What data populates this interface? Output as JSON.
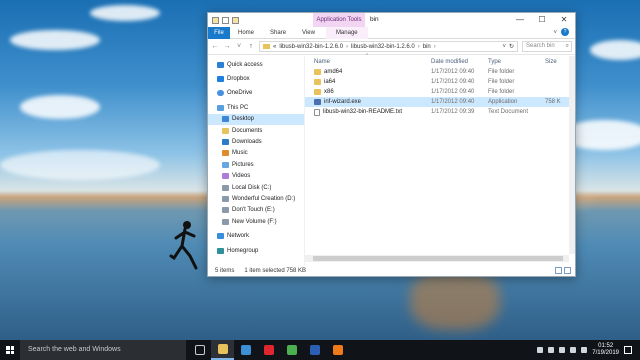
{
  "window": {
    "context_tab": "Application Tools",
    "title": "bin",
    "controls": {
      "minimize": "—",
      "maximize": "☐",
      "close": "✕"
    }
  },
  "ribbon": {
    "file": "File",
    "tabs": [
      "Home",
      "Share",
      "View"
    ],
    "manage": "Manage",
    "help": "?",
    "expand": "˅"
  },
  "address": {
    "back": "←",
    "forward": "→",
    "recent": "˅",
    "up": "↑",
    "prefix": "«",
    "crumbs": [
      "libusb-win32-bin-1.2.6.0",
      "libusb-win32-bin-1.2.6.0",
      "bin"
    ],
    "dropdown": "˅",
    "refresh": "↻",
    "search_placeholder": "Search bin",
    "search_icon": "⌕"
  },
  "nav": {
    "items": [
      {
        "label": "Quick access",
        "icon": "star-icon",
        "sub": false,
        "gap": false
      },
      {
        "label": "Dropbox",
        "icon": "dropbox-icon",
        "sub": false,
        "gap": true
      },
      {
        "label": "OneDrive",
        "icon": "cloud-icon",
        "sub": false,
        "gap": true
      },
      {
        "label": "This PC",
        "icon": "computer-icon",
        "sub": false,
        "gap": true
      },
      {
        "label": "Desktop",
        "icon": "desktop-folder-icon",
        "sub": true,
        "gap": false,
        "selected": true
      },
      {
        "label": "Documents",
        "icon": "documents-folder-icon",
        "sub": true,
        "gap": false
      },
      {
        "label": "Downloads",
        "icon": "downloads-folder-icon",
        "sub": true,
        "gap": false
      },
      {
        "label": "Music",
        "icon": "music-folder-icon",
        "sub": true,
        "gap": false
      },
      {
        "label": "Pictures",
        "icon": "pictures-folder-icon",
        "sub": true,
        "gap": false
      },
      {
        "label": "Videos",
        "icon": "videos-folder-icon",
        "sub": true,
        "gap": false
      },
      {
        "label": "Local Disk (C:)",
        "icon": "disk-icon",
        "sub": true,
        "gap": false
      },
      {
        "label": "Wonderful Creation (D:)",
        "icon": "disk-icon",
        "sub": true,
        "gap": false
      },
      {
        "label": "Don't Touch (E:)",
        "icon": "disk-icon",
        "sub": true,
        "gap": false
      },
      {
        "label": "New Volume (F:)",
        "icon": "disk-icon",
        "sub": true,
        "gap": false
      },
      {
        "label": "Network",
        "icon": "network-icon",
        "sub": false,
        "gap": true
      },
      {
        "label": "Homegroup",
        "icon": "homegroup-icon",
        "sub": false,
        "gap": true
      }
    ]
  },
  "files": {
    "headers": {
      "name": "Name",
      "date": "Date modified",
      "type": "Type",
      "size": "Size",
      "sort": "^"
    },
    "rows": [
      {
        "name": "amd64",
        "date": "1/17/2012 09:40",
        "type": "File folder",
        "size": "",
        "icon": "folder-icon"
      },
      {
        "name": "ia64",
        "date": "1/17/2012 09:40",
        "type": "File folder",
        "size": "",
        "icon": "folder-icon"
      },
      {
        "name": "x86",
        "date": "1/17/2012 09:40",
        "type": "File folder",
        "size": "",
        "icon": "folder-icon"
      },
      {
        "name": "inf-wizard.exe",
        "date": "1/17/2012 09:40",
        "type": "Application",
        "size": "758 K",
        "icon": "application-icon",
        "selected": true
      },
      {
        "name": "libusb-win32-bin-README.txt",
        "date": "1/17/2012 09:39",
        "type": "Text Document",
        "size": "",
        "icon": "text-file-icon"
      }
    ]
  },
  "status": {
    "count": "5 items",
    "selection": "1 item selected  758 KB"
  },
  "taskbar": {
    "search": "Search the web and Windows",
    "time": "01:52",
    "date": "7/19/2019",
    "apps": [
      {
        "name": "task-view-icon",
        "color": "#2b2f33"
      },
      {
        "name": "file-explorer-icon",
        "color": "#e8c25b",
        "active": true
      },
      {
        "name": "store-icon",
        "color": "#3d8fd6"
      },
      {
        "name": "opera-icon",
        "color": "#e0262f"
      },
      {
        "name": "chrome-icon",
        "color": "#4caf50"
      },
      {
        "name": "word-icon",
        "color": "#2b5fb3"
      },
      {
        "name": "app-orange-icon",
        "color": "#f07a1a"
      }
    ]
  }
}
